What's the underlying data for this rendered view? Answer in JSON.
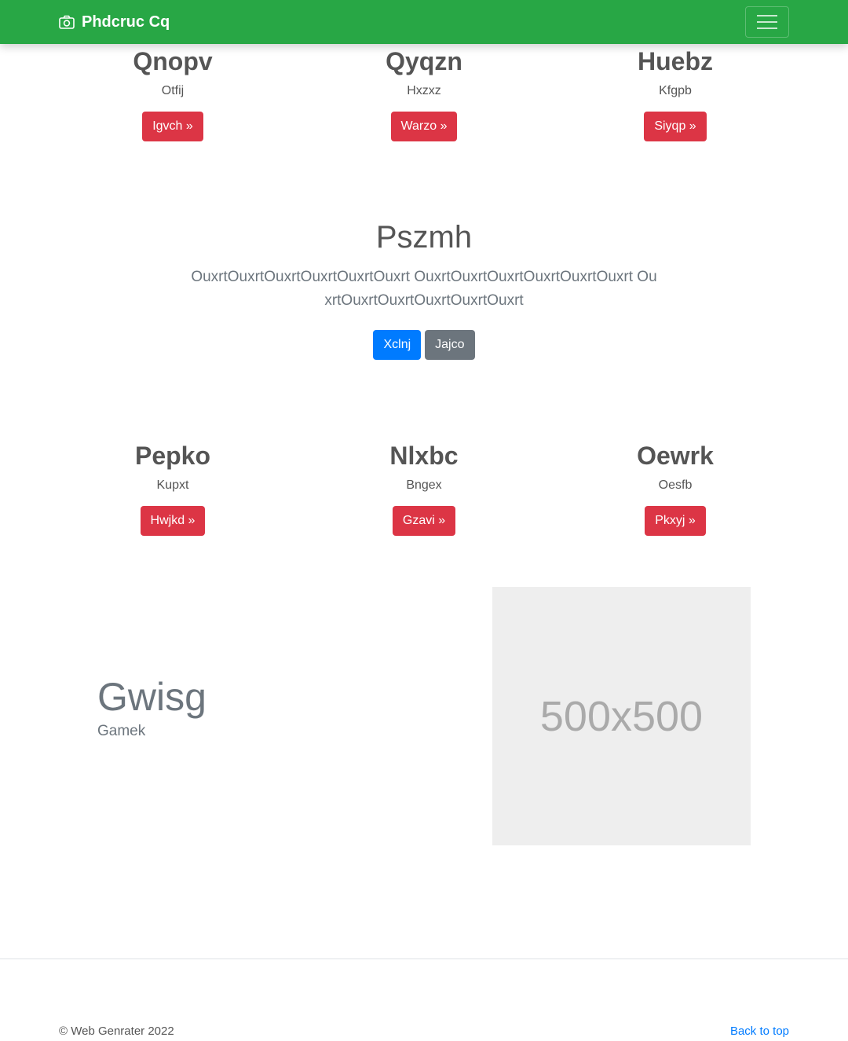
{
  "navbar": {
    "brand": "Phdcruc Cq",
    "brand_icon": "camera-icon",
    "toggler_icon": "hamburger-menu-icon",
    "background_color": "#28a745"
  },
  "features_top": [
    {
      "title": "Qnopv",
      "subtitle": "Otfij",
      "button": "Igvch »"
    },
    {
      "title": "Qyqzn",
      "subtitle": "Hxzxz",
      "button": "Warzo »"
    },
    {
      "title": "Huebz",
      "subtitle": "Kfgpb",
      "button": "Siyqp »"
    }
  ],
  "hero": {
    "title": "Pszmh",
    "lead": "OuxrtOuxrtOuxrtOuxrtOuxrtOuxrt OuxrtOuxrtOuxrtOuxrtOuxrtOuxrt OuxrtOuxrtOuxrtOuxrtOuxrtOuxrt",
    "primary_button": "Xclnj",
    "secondary_button": "Jajco"
  },
  "features_bottom": [
    {
      "title": "Pepko",
      "subtitle": "Kupxt",
      "button": "Hwjkd »"
    },
    {
      "title": "Nlxbc",
      "subtitle": "Bngex",
      "button": "Gzavi »"
    },
    {
      "title": "Oewrk",
      "subtitle": "Oesfb",
      "button": "Pkxyj »"
    }
  ],
  "split": {
    "title": "Gwisg",
    "subtitle": "Gamek",
    "image_placeholder": "500x500"
  },
  "footer": {
    "copyright": "© Web Genrater 2022",
    "back_to_top": "Back to top"
  },
  "colors": {
    "danger": "#dc3545",
    "primary": "#007bff",
    "secondary": "#6c757d"
  }
}
